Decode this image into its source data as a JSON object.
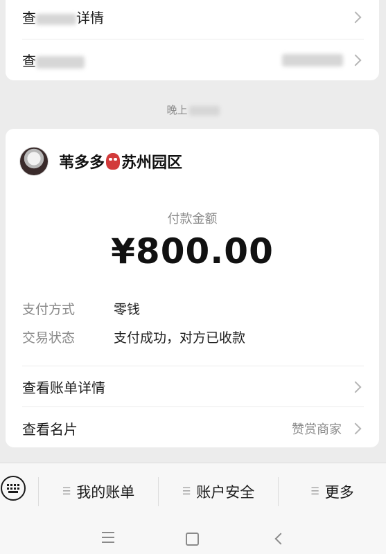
{
  "top_card": {
    "row1_label_start": "查",
    "row1_label_end": "详情",
    "row2_label_start": "查"
  },
  "time_label_start": "晚上",
  "payment": {
    "merchant_name": "苇多多",
    "merchant_suffix": "苏州园区",
    "amount_label": "付款金额",
    "amount": "¥800.00",
    "fields": [
      {
        "label": "支付方式",
        "value": "零钱"
      },
      {
        "label": "交易状态",
        "value": "支付成功，对方已收款"
      }
    ],
    "bill_detail_label": "查看账单详情",
    "card_label": "查看名片",
    "card_action": "赞赏商家"
  },
  "bottom_menu": {
    "items": [
      "我的账单",
      "账户安全",
      "更多"
    ]
  },
  "icons": {
    "mask": "mask-emoji-icon",
    "keyboard": "keyboard-icon"
  }
}
